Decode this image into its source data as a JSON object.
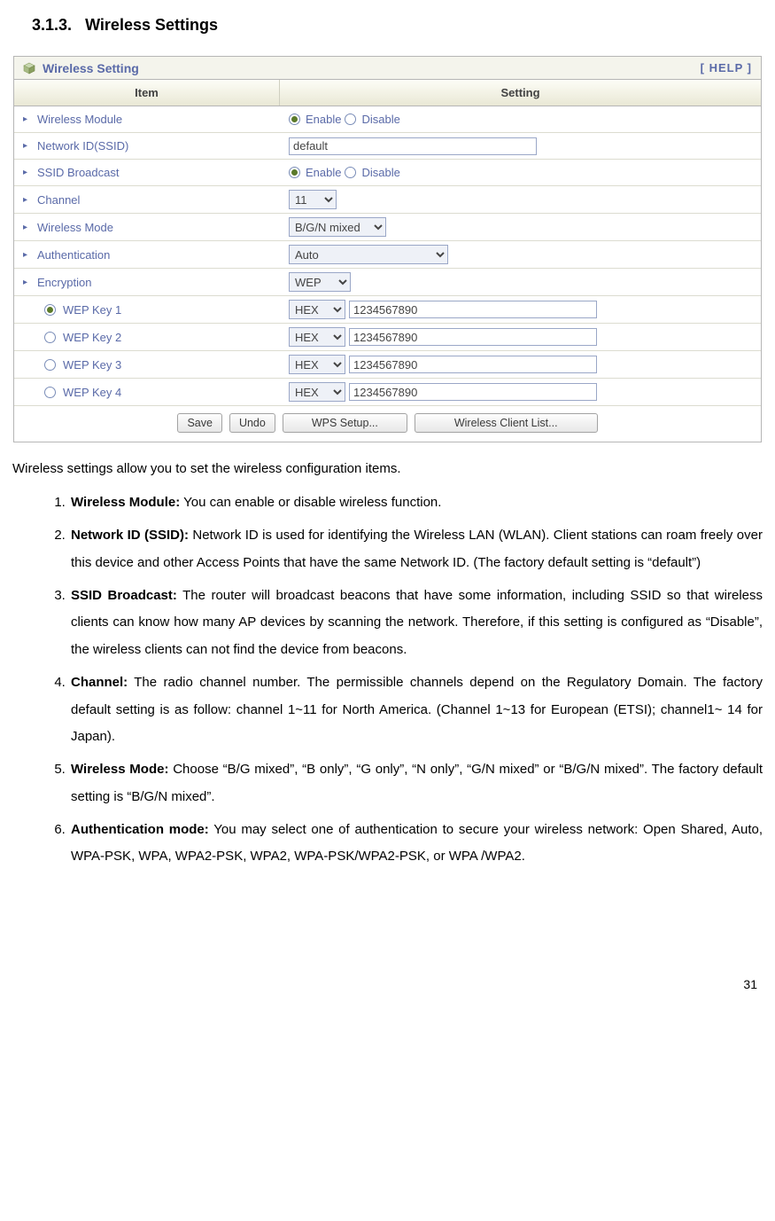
{
  "section_number": "3.1.3.",
  "section_title": "Wireless Settings",
  "panel": {
    "title": "Wireless Setting",
    "help": "[ HELP ]",
    "headers": {
      "item": "Item",
      "setting": "Setting"
    },
    "rows": {
      "wireless_module": {
        "label": "Wireless Module",
        "enable": "Enable",
        "disable": "Disable"
      },
      "network_id": {
        "label": "Network ID(SSID)",
        "value": "default"
      },
      "ssid_broadcast": {
        "label": "SSID Broadcast",
        "enable": "Enable",
        "disable": "Disable"
      },
      "channel": {
        "label": "Channel",
        "value": "11"
      },
      "wireless_mode": {
        "label": "Wireless Mode",
        "value": "B/G/N mixed"
      },
      "authentication": {
        "label": "Authentication",
        "value": "Auto"
      },
      "encryption": {
        "label": "Encryption",
        "value": "WEP"
      },
      "wep1": {
        "label": "WEP Key 1",
        "type": "HEX",
        "value": "1234567890"
      },
      "wep2": {
        "label": "WEP Key 2",
        "type": "HEX",
        "value": "1234567890"
      },
      "wep3": {
        "label": "WEP Key 3",
        "type": "HEX",
        "value": "1234567890"
      },
      "wep4": {
        "label": "WEP Key 4",
        "type": "HEX",
        "value": "1234567890"
      }
    },
    "buttons": {
      "save": "Save",
      "undo": "Undo",
      "wps": "WPS Setup...",
      "client_list": "Wireless Client List..."
    }
  },
  "intro": "Wireless settings allow you to set the wireless configuration items.",
  "items": [
    {
      "term": "Wireless Module:",
      "text": " You can enable or disable wireless function."
    },
    {
      "term": "Network ID (SSID):",
      "text": " Network ID is used for identifying the Wireless LAN (WLAN). Client stations can roam freely over this device and other Access Points that have the same Network ID. (The factory default setting is “default”)"
    },
    {
      "term": "SSID Broadcast:",
      "text": " The router will broadcast beacons that have some information, including SSID so that wireless clients can know how many AP devices by scanning the network. Therefore, if this setting is configured as “Disable”, the wireless clients can not find the device from beacons."
    },
    {
      "term": "Channel:",
      "text": " The radio channel number. The permissible channels depend on the Regulatory Domain. The factory default setting is as follow: channel 1~11 for North America. (Channel 1~13 for European (ETSI); channel1~ 14 for Japan)."
    },
    {
      "term": "Wireless Mode:",
      "text": " Choose “B/G mixed”, “B only”, “G only”, “N only”, “G/N mixed” or “B/G/N mixed”. The factory default setting is “B/G/N mixed”."
    },
    {
      "term": "Authentication mode:",
      "text": " You may select one of authentication to secure your wireless network: Open Shared, Auto, WPA-PSK, WPA, WPA2-PSK, WPA2, WPA-PSK/WPA2-PSK, or WPA /WPA2."
    }
  ],
  "page_number": "31"
}
